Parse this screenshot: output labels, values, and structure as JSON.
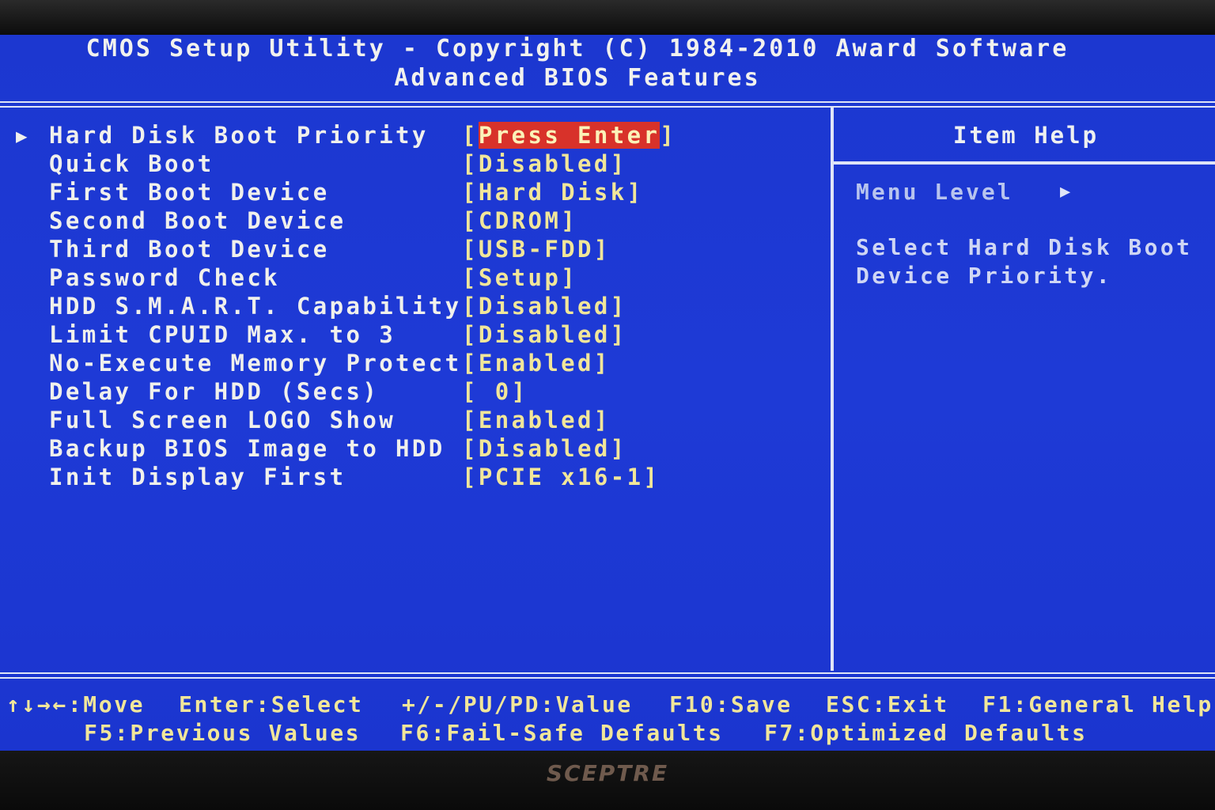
{
  "header": {
    "title": "CMOS Setup Utility - Copyright (C) 1984-2010 Award Software",
    "subtitle": "Advanced BIOS Features"
  },
  "settings": [
    {
      "label": "Hard Disk Boot Priority",
      "value": "Press Enter",
      "submenu": true,
      "selected": true
    },
    {
      "label": "Quick Boot",
      "value": "Disabled"
    },
    {
      "label": "First Boot Device",
      "value": "Hard Disk"
    },
    {
      "label": "Second Boot Device",
      "value": "CDROM"
    },
    {
      "label": "Third Boot Device",
      "value": "USB-FDD"
    },
    {
      "label": "Password Check",
      "value": "Setup"
    },
    {
      "label": "HDD S.M.A.R.T. Capability",
      "value": "Disabled"
    },
    {
      "label": "Limit CPUID Max. to 3",
      "value": "Disabled"
    },
    {
      "label": "No-Execute Memory Protect",
      "value": "Enabled"
    },
    {
      "label": "Delay For HDD (Secs)",
      "value": " 0"
    },
    {
      "label": "Full Screen LOGO Show",
      "value": "Enabled"
    },
    {
      "label": "Backup BIOS Image to HDD",
      "value": "Disabled"
    },
    {
      "label": "Init Display First",
      "value": "PCIE x16-1"
    }
  ],
  "help": {
    "title": "Item Help",
    "menu_level_label": "Menu Level",
    "text_line1": "Select Hard Disk Boot",
    "text_line2": "Device Priority."
  },
  "footer": {
    "row1": [
      "↑↓→←:Move",
      "Enter:Select",
      "+/-/PU/PD:Value",
      "F10:Save",
      "ESC:Exit",
      "F1:General Help"
    ],
    "row2": [
      "F5:Previous Values",
      "F6:Fail-Safe Defaults",
      "F7:Optimized Defaults"
    ]
  },
  "monitor": {
    "brand": "SCEPTRE"
  },
  "colors": {
    "background": "#1e3ad6",
    "setting_label": "#f0f0ec",
    "setting_value": "#f1e69a",
    "highlight": "#d8322a",
    "help_text": "#cfd6f4"
  }
}
